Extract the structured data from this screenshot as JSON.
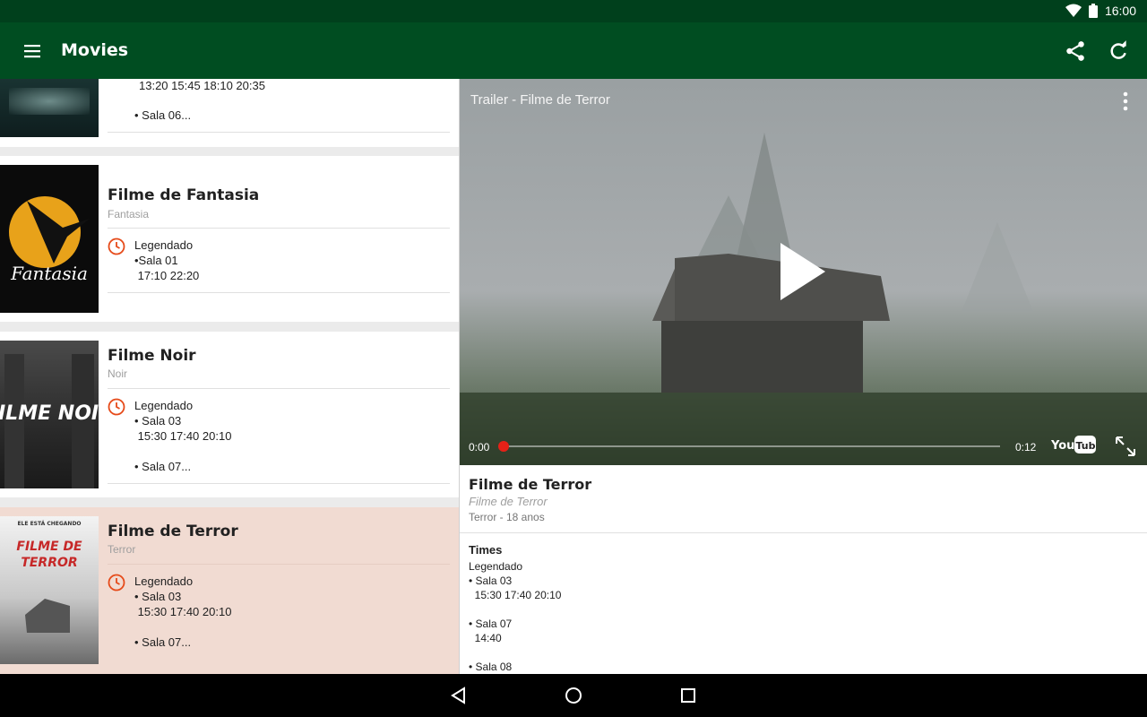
{
  "status": {
    "time": "16:00"
  },
  "appbar": {
    "title": "Movies"
  },
  "list": {
    "partial": {
      "times": "13:20 15:45 18:10 20:35",
      "more": "• Sala 06..."
    },
    "items": [
      {
        "title": "Filme de Fantasia",
        "genre": "Fantasia",
        "lines": [
          "Legendado",
          "•Sala 01",
          " 17:10 22:20"
        ],
        "poster_text": "Fantasia"
      },
      {
        "title": "Filme Noir",
        "genre": "Noir",
        "lines": [
          "Legendado",
          "• Sala 03",
          " 15:30 17:40 20:10",
          "",
          "• Sala 07..."
        ],
        "poster_text": "FILME NOIR"
      },
      {
        "title": "Filme de Terror",
        "genre": "Terror",
        "lines": [
          "Legendado",
          "• Sala 03",
          " 15:30 17:40 20:10",
          "",
          "• Sala 07..."
        ],
        "poster_text": "FILME DE TERROR",
        "poster_top": "ELE ESTÁ CHEGANDO",
        "selected": true
      }
    ]
  },
  "video": {
    "title": "Trailer - Filme de Terror",
    "current_time": "0:00",
    "duration": "0:12",
    "progress": 0.0,
    "brand": "YouTube"
  },
  "detail": {
    "title": "Filme de Terror",
    "original_title": "Filme de Terror",
    "meta": "Terror - 18 anos",
    "times_heading": "Times",
    "lines": [
      "Legendado",
      "• Sala 03",
      "  15:30 17:40 20:10",
      "",
      "• Sala 07",
      "  14:40",
      "",
      "• Sala 08"
    ]
  },
  "colors": {
    "primary_dark": "#00401c",
    "primary": "#004d21",
    "accent": "#e64a19",
    "selected_bg": "#f1dbd2"
  }
}
